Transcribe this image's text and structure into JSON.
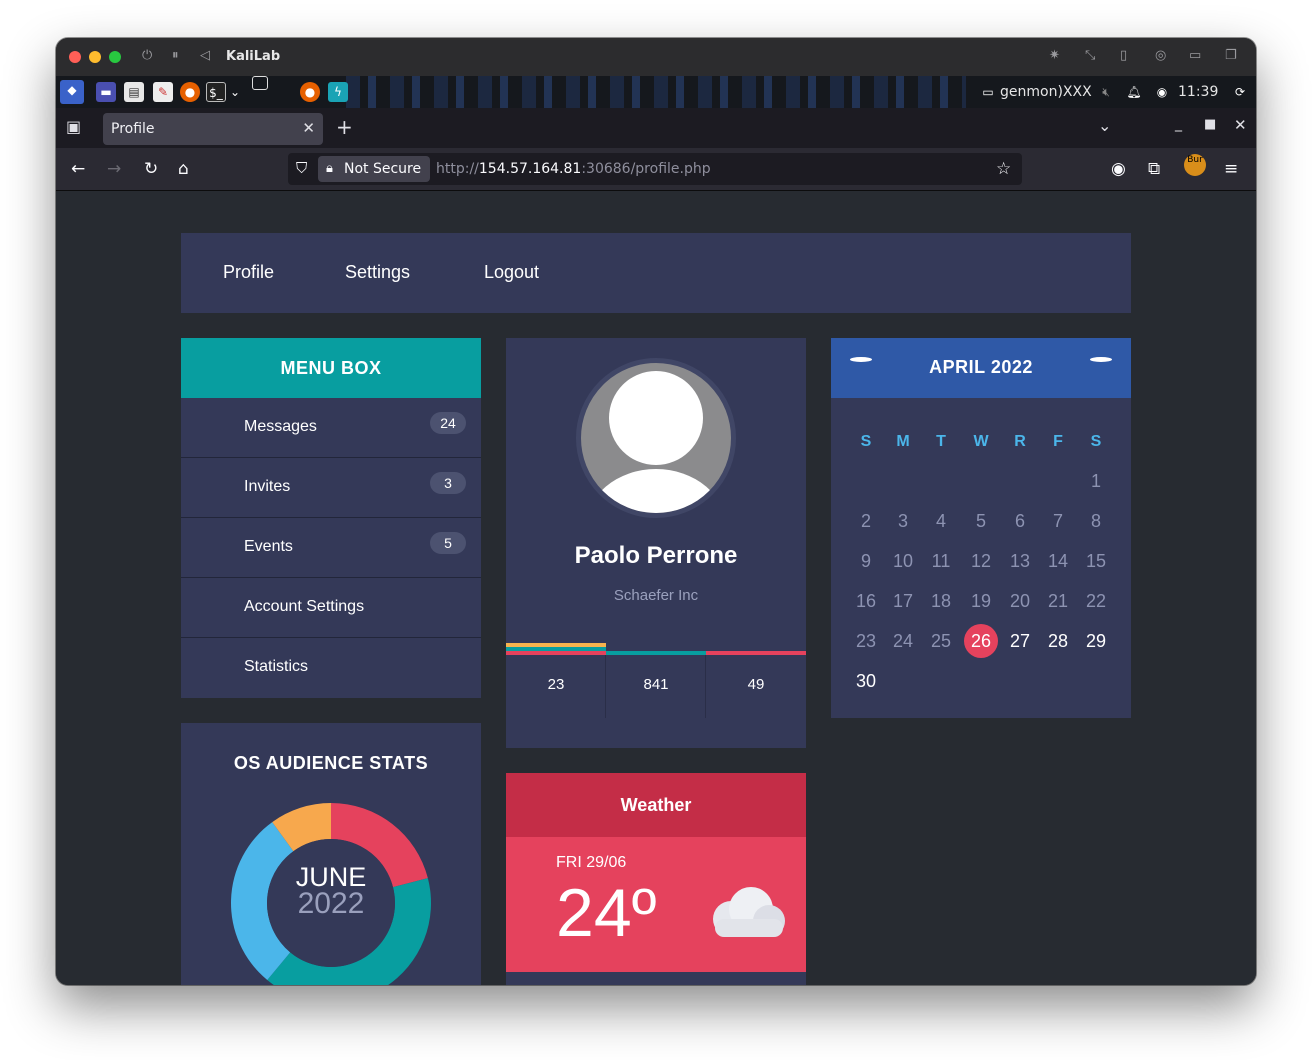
{
  "window": {
    "title": "KaliLab"
  },
  "panel": {
    "genmon_text": "genmon)XXX",
    "clock": "11:39"
  },
  "browser": {
    "tab_title": "Profile",
    "security_label": "Not Secure",
    "url_prefix": "http://",
    "url_host": "154.57.164.81",
    "url_rest": ":30686/profile.php"
  },
  "topnav": {
    "items": [
      "Profile",
      "Settings",
      "Logout"
    ]
  },
  "menubox": {
    "title": "MENU BOX",
    "items": [
      {
        "label": "Messages",
        "badge": "24"
      },
      {
        "label": "Invites",
        "badge": "3"
      },
      {
        "label": "Events",
        "badge": "5"
      },
      {
        "label": "Account Settings",
        "badge": ""
      },
      {
        "label": "Statistics",
        "badge": ""
      }
    ]
  },
  "profile": {
    "name": "Paolo Perrone",
    "company": "Schaefer Inc",
    "stats": [
      {
        "value": "23",
        "colors": [
          "#f7b34d",
          "#089ea0",
          "#e5425d"
        ]
      },
      {
        "value": "841",
        "colors": [
          "#089ea0"
        ]
      },
      {
        "value": "49",
        "colors": [
          "#e5425d"
        ]
      }
    ]
  },
  "calendar": {
    "title": "APRIL 2022",
    "weekdays": [
      "S",
      "M",
      "T",
      "W",
      "R",
      "F",
      "S"
    ],
    "first_weekday_index": 6,
    "days_in_month": 30,
    "today": 26
  },
  "os_stats": {
    "title": "OS AUDIENCE STATS",
    "center_month": "JUNE",
    "center_year": "2022",
    "segments": [
      {
        "color": "#e5425d",
        "value": 0.21
      },
      {
        "color": "#089ea0",
        "value": 0.4
      },
      {
        "color": "#4bb6ea",
        "value": 0.29
      },
      {
        "color": "#f7a84d",
        "value": 0.1
      }
    ]
  },
  "weather": {
    "title": "Weather",
    "date": "FRI 29/06",
    "temp": "24º",
    "icon": "cloud-icon"
  },
  "colors": {
    "page_bg": "#272b31",
    "card_bg": "#343958",
    "teal": "#089ea0",
    "red": "#e5425d",
    "blue": "#2f59a7",
    "light_blue": "#4bb6ea",
    "orange": "#f7a84d"
  }
}
